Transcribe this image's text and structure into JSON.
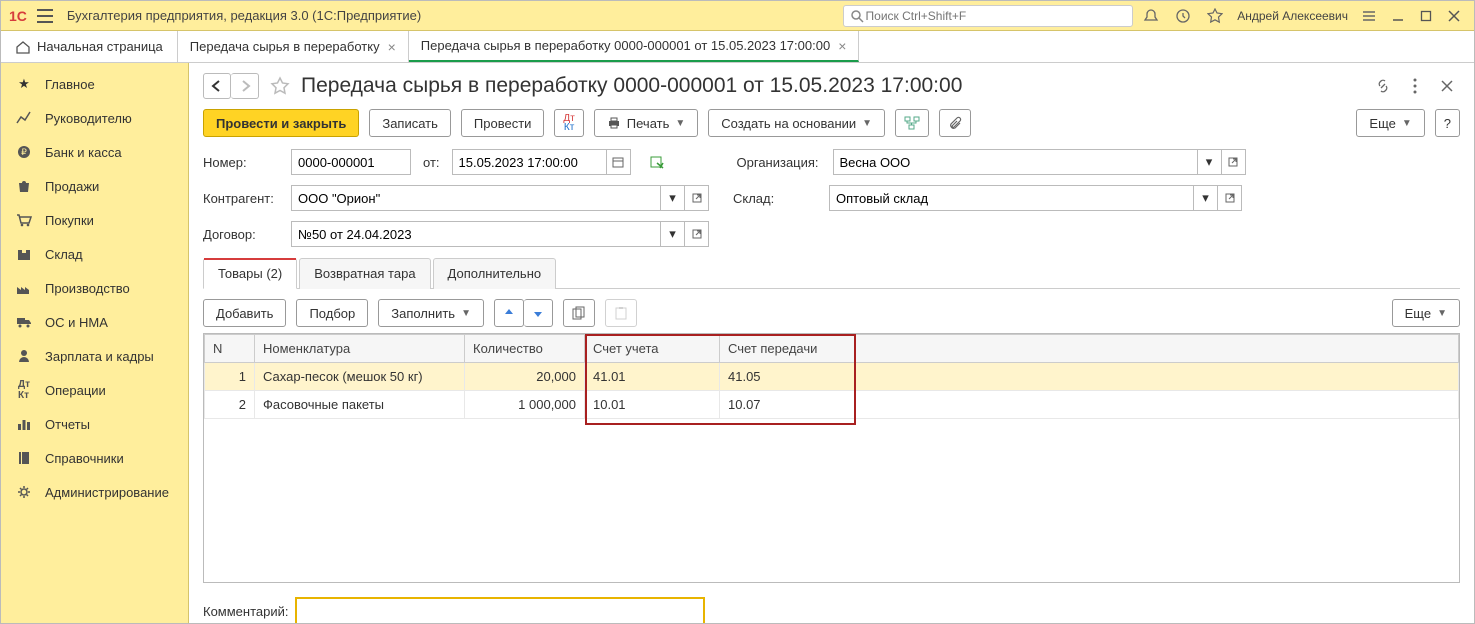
{
  "titlebar": {
    "app_title": "Бухгалтерия предприятия, редакция 3.0  (1С:Предприятие)",
    "search_placeholder": "Поиск Ctrl+Shift+F",
    "user_name": "Андрей Алексеевич"
  },
  "nav": {
    "home": "Начальная страница",
    "tabs": [
      {
        "label": "Передача сырья в переработку"
      },
      {
        "label": "Передача сырья в переработку 0000-000001 от 15.05.2023 17:00:00",
        "active": true
      }
    ]
  },
  "sidebar": {
    "items": [
      {
        "label": "Главное",
        "icon": "star"
      },
      {
        "label": "Руководителю",
        "icon": "chart"
      },
      {
        "label": "Банк и касса",
        "icon": "coin"
      },
      {
        "label": "Продажи",
        "icon": "bag"
      },
      {
        "label": "Покупки",
        "icon": "cart"
      },
      {
        "label": "Склад",
        "icon": "box"
      },
      {
        "label": "Производство",
        "icon": "factory"
      },
      {
        "label": "ОС и НМА",
        "icon": "truck"
      },
      {
        "label": "Зарплата и кадры",
        "icon": "person"
      },
      {
        "label": "Операции",
        "icon": "dtkt"
      },
      {
        "label": "Отчеты",
        "icon": "bars"
      },
      {
        "label": "Справочники",
        "icon": "book"
      },
      {
        "label": "Администрирование",
        "icon": "gear"
      }
    ]
  },
  "document": {
    "title": "Передача сырья в переработку 0000-000001 от 15.05.2023 17:00:00",
    "toolbar": {
      "post_and_close": "Провести и закрыть",
      "save": "Записать",
      "post": "Провести",
      "print": "Печать",
      "create_based_on": "Создать на основании",
      "more": "Еще"
    },
    "fields": {
      "number_label": "Номер:",
      "number_value": "0000-000001",
      "from_label": "от:",
      "date_value": "15.05.2023 17:00:00",
      "org_label": "Организация:",
      "org_value": "Весна ООО",
      "contractor_label": "Контрагент:",
      "contractor_value": "ООО \"Орион\"",
      "warehouse_label": "Склад:",
      "warehouse_value": "Оптовый склад",
      "contract_label": "Договор:",
      "contract_value": "№50 от 24.04.2023"
    },
    "tabs": [
      {
        "label": "Товары (2)",
        "active": true
      },
      {
        "label": "Возвратная тара"
      },
      {
        "label": "Дополнительно"
      }
    ],
    "table_toolbar": {
      "add": "Добавить",
      "pick": "Подбор",
      "fill": "Заполнить",
      "more": "Еще"
    },
    "table": {
      "columns": {
        "n": "N",
        "nomenclature": "Номенклатура",
        "quantity": "Количество",
        "account_uchet": "Счет учета",
        "account_transfer": "Счет передачи"
      },
      "rows": [
        {
          "n": "1",
          "name": "Сахар-песок (мешок 50 кг)",
          "qty": "20,000",
          "acc1": "41.01",
          "acc2": "41.05"
        },
        {
          "n": "2",
          "name": "Фасовочные пакеты",
          "qty": "1 000,000",
          "acc1": "10.01",
          "acc2": "10.07"
        }
      ]
    },
    "comment_label": "Комментарий:",
    "comment_value": ""
  }
}
